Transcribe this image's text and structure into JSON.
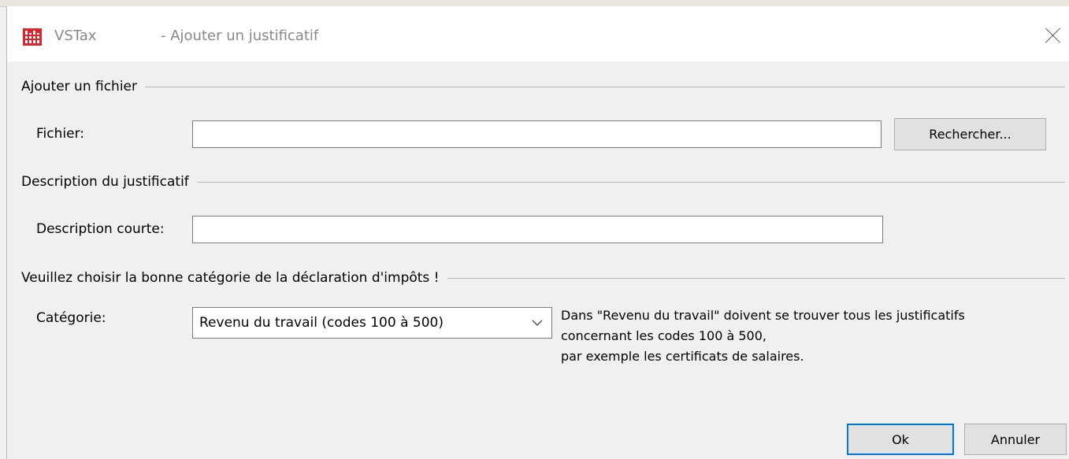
{
  "window": {
    "app_name": "VSTax",
    "title": "- Ajouter un justificatif"
  },
  "file_group": {
    "heading": "Ajouter un fichier",
    "field_label": "Fichier:",
    "field_value": "",
    "browse_label": "Rechercher..."
  },
  "description_group": {
    "heading": "Description du justificatif",
    "field_label": "Description courte:",
    "field_value": ""
  },
  "category_group": {
    "heading": "Veuillez choisir la bonne catégorie de la déclaration d'impôts !",
    "field_label": "Catégorie:",
    "selected": "Revenu du travail (codes 100 à 500)",
    "help_lines": [
      "Dans \"Revenu du travail\" doivent se trouver tous les justificatifs",
      "concernant les codes 100 à 500,",
      "par exemple les certificats de salaires."
    ]
  },
  "footer": {
    "ok_label": "Ok",
    "cancel_label": "Annuler"
  },
  "icons": {
    "app": "vstax-logo-icon",
    "close": "close-icon",
    "dropdown": "chevron-down-icon"
  },
  "colors": {
    "accent": "#0078d7",
    "app_icon": "#d9262d"
  }
}
